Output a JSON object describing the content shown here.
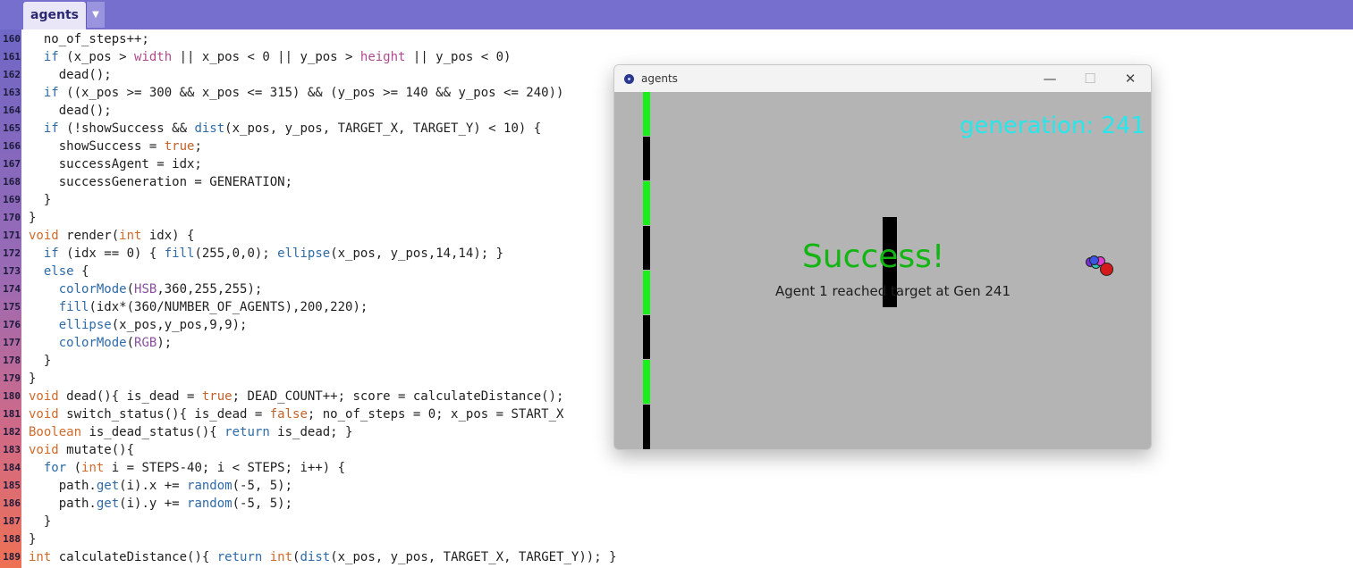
{
  "editor": {
    "tab_label": "agents",
    "tab_menu_icon": "dropdown-arrow-icon",
    "tab_menu_glyph": "▼"
  },
  "code": {
    "lines": [
      {
        "n": "160",
        "text": "  no_of_steps++;"
      },
      {
        "n": "161",
        "text": "  if (x_pos > width || x_pos < 0 || y_pos > height || y_pos < 0)"
      },
      {
        "n": "162",
        "text": "    dead();"
      },
      {
        "n": "163",
        "text": "  if ((x_pos >= 300 && x_pos <= 315) && (y_pos >= 140 && y_pos <= 240))"
      },
      {
        "n": "164",
        "text": "    dead();"
      },
      {
        "n": "165",
        "text": "  if (!showSuccess && dist(x_pos, y_pos, TARGET_X, TARGET_Y) < 10) {"
      },
      {
        "n": "166",
        "text": "    showSuccess = true;"
      },
      {
        "n": "167",
        "text": "    successAgent = idx;"
      },
      {
        "n": "168",
        "text": "    successGeneration = GENERATION;"
      },
      {
        "n": "169",
        "text": "  }"
      },
      {
        "n": "170",
        "text": "}"
      },
      {
        "n": "171",
        "text": "void render(int idx) {"
      },
      {
        "n": "172",
        "text": "  if (idx == 0) { fill(255,0,0); ellipse(x_pos, y_pos,14,14); }"
      },
      {
        "n": "173",
        "text": "  else {"
      },
      {
        "n": "174",
        "text": "    colorMode(HSB,360,255,255);"
      },
      {
        "n": "175",
        "text": "    fill(idx*(360/NUMBER_OF_AGENTS),200,220);"
      },
      {
        "n": "176",
        "text": "    ellipse(x_pos,y_pos,9,9);"
      },
      {
        "n": "177",
        "text": "    colorMode(RGB);"
      },
      {
        "n": "178",
        "text": "  }"
      },
      {
        "n": "179",
        "text": "}"
      },
      {
        "n": "180",
        "text": "void dead(){ is_dead = true; DEAD_COUNT++; score = calculateDistance();"
      },
      {
        "n": "181",
        "text": "void switch_status(){ is_dead = false; no_of_steps = 0; x_pos = START_X"
      },
      {
        "n": "182",
        "text": "Boolean is_dead_status(){ return is_dead; }"
      },
      {
        "n": "183",
        "text": "void mutate(){"
      },
      {
        "n": "184",
        "text": "  for (int i = STEPS-40; i < STEPS; i++) {"
      },
      {
        "n": "185",
        "text": "    path.get(i).x += random(-5, 5);"
      },
      {
        "n": "186",
        "text": "    path.get(i).y += random(-5, 5);"
      },
      {
        "n": "187",
        "text": "  }"
      },
      {
        "n": "188",
        "text": "}"
      },
      {
        "n": "189",
        "text": "int calculateDistance(){ return int(dist(x_pos, y_pos, TARGET_X, TARGET_Y)); }"
      }
    ]
  },
  "sketch_window": {
    "title": "agents",
    "app_icon": "processing-app-icon",
    "minimize_glyph": "—",
    "maximize_glyph": "☐",
    "close_glyph": "✕",
    "generation_label": "generation: 241",
    "success_title": "Success!",
    "success_message": "Agent 1 reached target at Gen 241"
  },
  "colors": {
    "wall_green": "#19f019",
    "wall_black": "#000000",
    "generation_text": "#29e6ea",
    "success_text": "#13b513",
    "agent_red": "#d41a1a"
  }
}
